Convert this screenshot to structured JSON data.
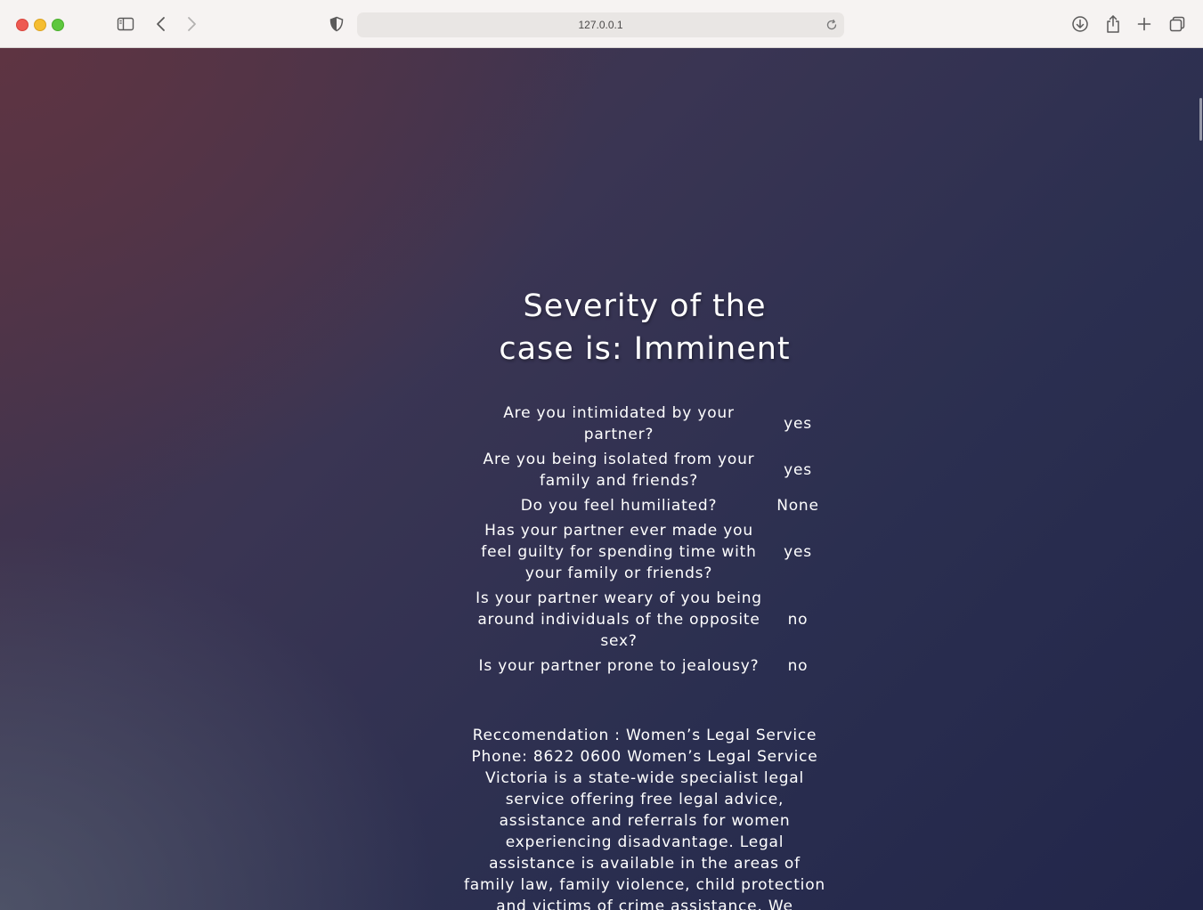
{
  "browser": {
    "url": "127.0.0.1",
    "icons": {
      "sidebar": "sidebar-icon",
      "back": "chevron-left-icon",
      "forward": "chevron-right-icon",
      "privacy": "shield-icon",
      "reload": "reload-icon",
      "download": "download-icon",
      "share": "share-icon",
      "new_tab": "plus-icon",
      "tabs": "tab-overview-icon"
    }
  },
  "page": {
    "title": "Severity of the case is: Imminent",
    "questions": [
      {
        "question": "Are you intimidated by your partner?",
        "answer": "yes"
      },
      {
        "question": "Are you being isolated from your family and friends?",
        "answer": "yes"
      },
      {
        "question": "Do you feel humiliated?",
        "answer": "None"
      },
      {
        "question": "Has your partner ever made you feel guilty for spending time with your family or friends?",
        "answer": "yes"
      },
      {
        "question": "Is your partner weary of you being around individuals of the opposite sex?",
        "answer": "no"
      },
      {
        "question": "Is your partner prone to jealousy?",
        "answer": "no"
      }
    ],
    "recommendation": "Reccomendation : Women’s Legal Service Phone: 8622 0600 Women’s Legal Service Victoria is a state-wide specialist legal service offering free legal advice, assistance and referrals for women experiencing disadvantage. Legal assistance is available in the areas of family law, family violence, child protection and victims of crime assistance. We provide duty lawyer"
  },
  "colors": {
    "toolbar_bg": "#f6f3f2",
    "address_bg": "#e9e6e4",
    "page_text": "#ffffff",
    "gradient_start": "#4d3346",
    "gradient_end": "#22264a"
  }
}
